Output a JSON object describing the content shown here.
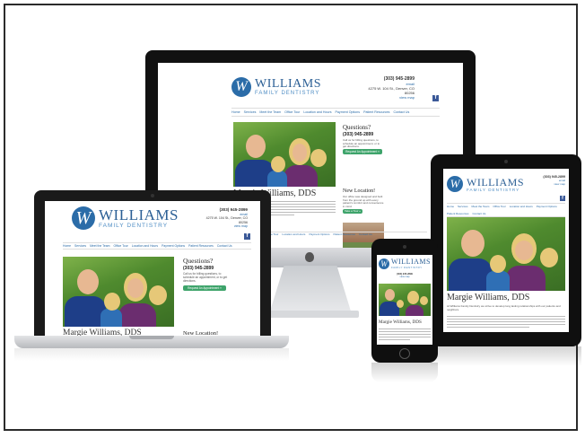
{
  "site": {
    "logo_mark": "W",
    "name_line1": "WILLIAMS",
    "name_line2": "FAMILY DENTISTRY",
    "phone_small": "(303) 945-2899",
    "contact_line1": "email",
    "address_line": "4275 W. 104 St., Denver, CO 80256",
    "map_link": "view map",
    "nav": [
      "Home",
      "Services",
      "Meet the Team",
      "Office Tour",
      "Location and Hours",
      "Payment Options",
      "Patient Resources",
      "Contact Us"
    ],
    "doctor_title": "Margie Williams, DDS",
    "questions_heading": "Questions?",
    "questions_phone": "(303) 945-2899",
    "questions_body": "Call us for billing questions, to schedule an appointment, or to get directions.",
    "request_button": "Request An Appointment »",
    "new_location_heading": "New Location!",
    "new_location_body": "Our office was designed and built from the ground up with every patient's comfort and convenience in mind.",
    "tour_button": "Take a Tour »",
    "intro_text": "At Williams Family Dentistry we strive to develop long lasting relationships with our patients and neighbors."
  },
  "colors": {
    "brand_blue": "#2b6ca8",
    "accent_green": "#3ea46b"
  },
  "icons": {
    "facebook": "facebook-icon",
    "apple": "apple-logo-icon"
  }
}
